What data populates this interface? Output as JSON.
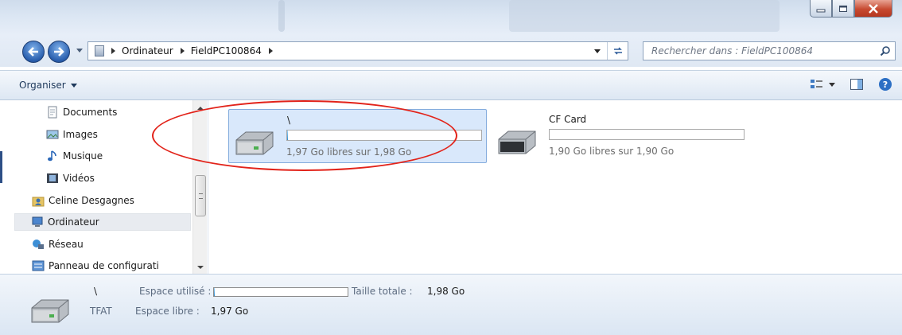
{
  "window": {
    "buttons": {
      "minimize": "minimize",
      "maximize": "maximize",
      "close": "close"
    }
  },
  "navigation": {
    "back_icon": "back-arrow-icon",
    "forward_icon": "forward-arrow-icon",
    "breadcrumbs": [
      "Ordinateur",
      "FieldPC100864"
    ],
    "search_placeholder": "Rechercher dans : FieldPC100864"
  },
  "toolbar": {
    "organize_label": "Organiser"
  },
  "sidebar": {
    "items": [
      {
        "label": "Documents",
        "icon": "document-icon"
      },
      {
        "label": "Images",
        "icon": "image-icon"
      },
      {
        "label": "Musique",
        "icon": "music-icon"
      },
      {
        "label": "Vidéos",
        "icon": "video-icon"
      },
      {
        "label": "Celine Desgagnes",
        "icon": "user-folder-icon"
      },
      {
        "label": "Ordinateur",
        "icon": "computer-icon",
        "selected": true
      },
      {
        "label": "Réseau",
        "icon": "network-icon"
      },
      {
        "label": "Panneau de configurati",
        "icon": "control-panel-icon"
      }
    ]
  },
  "drives": [
    {
      "name": "\\",
      "free_text": "1,97 Go libres sur 1,98 Go",
      "used_fraction": 0.005,
      "selected": true
    },
    {
      "name": "CF Card",
      "free_text": "1,90 Go libres sur 1,90 Go",
      "used_fraction": 0.0,
      "selected": false
    }
  ],
  "details": {
    "name": "\\",
    "filesystem": "TFAT",
    "used_label": "Espace utilisé :",
    "used_fraction": 0.005,
    "total_label": "Taille totale :",
    "total_value": "1,98 Go",
    "free_label": "Espace libre :",
    "free_value": "1,97 Go"
  },
  "colors": {
    "accent": "#2c8fd6",
    "selection": "#d9e8fb",
    "annotation": "#e2231a"
  }
}
